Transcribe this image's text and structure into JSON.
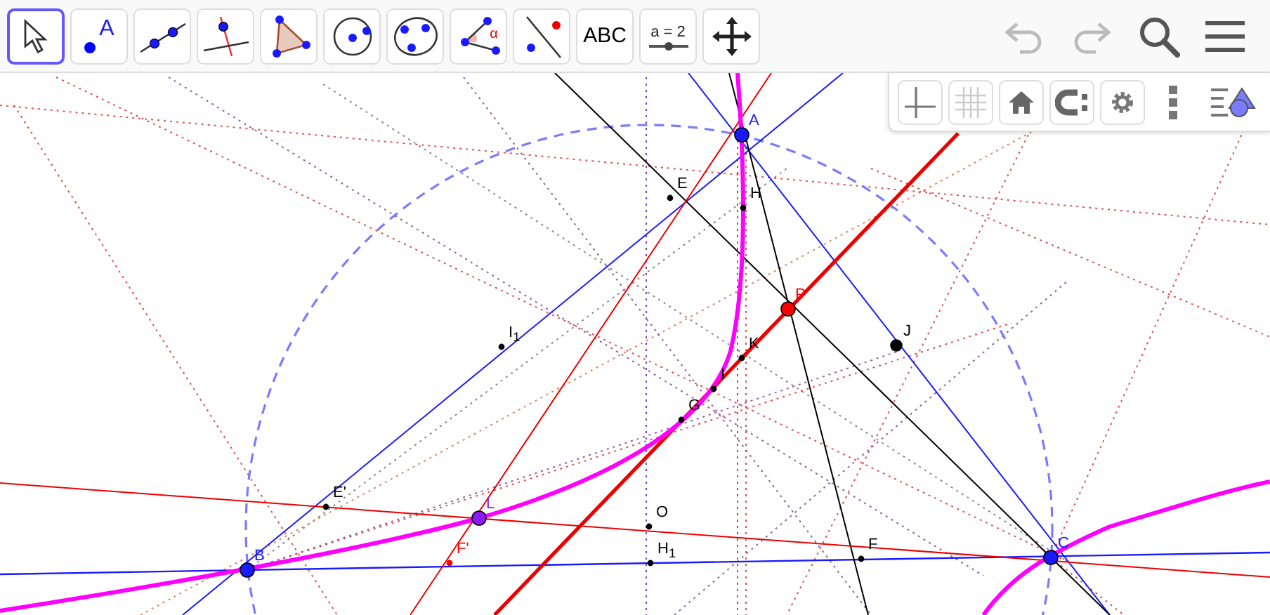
{
  "toolbar": {
    "tools": [
      {
        "kind": "move",
        "selected": true
      },
      {
        "kind": "point",
        "selected": false,
        "text": "A"
      },
      {
        "kind": "line",
        "selected": false
      },
      {
        "kind": "perpendicular",
        "selected": false
      },
      {
        "kind": "polygon",
        "selected": false
      },
      {
        "kind": "circle",
        "selected": false
      },
      {
        "kind": "conic",
        "selected": false
      },
      {
        "kind": "angle",
        "selected": false,
        "text": "α"
      },
      {
        "kind": "reflect",
        "selected": false
      },
      {
        "kind": "text",
        "selected": false,
        "text": "ABC"
      },
      {
        "kind": "slider",
        "selected": false,
        "text": "a = 2"
      },
      {
        "kind": "pan",
        "selected": false
      }
    ],
    "actions": [
      {
        "kind": "undo",
        "disabled": true
      },
      {
        "kind": "redo",
        "disabled": true
      },
      {
        "kind": "search",
        "disabled": false
      },
      {
        "kind": "menu",
        "disabled": false
      }
    ]
  },
  "style_bar": {
    "buttons": [
      {
        "kind": "axes",
        "selected": false
      },
      {
        "kind": "grid",
        "selected": false
      },
      {
        "kind": "home",
        "selected": false
      },
      {
        "kind": "magnet",
        "selected": false
      },
      {
        "kind": "settings",
        "selected": false
      },
      {
        "kind": "more",
        "selected": false
      },
      {
        "kind": "panel",
        "selected": false
      }
    ]
  },
  "points": [
    {
      "label": "A",
      "color": "#1a1aff",
      "kind": "large"
    },
    {
      "label": "H",
      "color": "#000000",
      "kind": "small"
    },
    {
      "label": "E",
      "color": "#000000",
      "kind": "small"
    },
    {
      "label": "P",
      "color": "#ff0000",
      "kind": "large"
    },
    {
      "label": "J",
      "color": "#000000",
      "kind": "medium"
    },
    {
      "label": "K",
      "color": "#000000",
      "kind": "small"
    },
    {
      "label": "I",
      "color": "#000000",
      "kind": "small"
    },
    {
      "label": "G",
      "color": "#000000",
      "kind": "small"
    },
    {
      "label": "I$_{1}$",
      "color": "#000000",
      "kind": "small"
    },
    {
      "label": "E'",
      "color": "#000000",
      "kind": "small"
    },
    {
      "label": "L",
      "color": "#8c1aff",
      "kind": "large"
    },
    {
      "label": "O",
      "color": "#000000",
      "kind": "small"
    },
    {
      "label": "B",
      "color": "#1a1aff",
      "kind": "large"
    },
    {
      "label": "F'",
      "color": "#ff0000",
      "kind": "small"
    },
    {
      "label": "H$_{1}$",
      "color": "#000000",
      "kind": "small"
    },
    {
      "label": "F",
      "color": "#000000",
      "kind": "small"
    },
    {
      "label": "C",
      "color": "#1a1aff",
      "kind": "large"
    }
  ]
}
